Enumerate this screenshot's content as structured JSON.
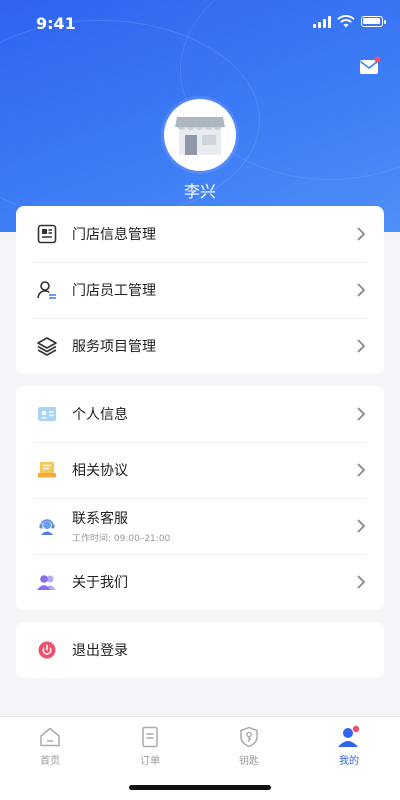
{
  "status_bar": {
    "time": "9:41"
  },
  "profile": {
    "name": "李兴"
  },
  "menu_group_1": [
    {
      "label": "门店信息管理",
      "icon": "store-info-icon"
    },
    {
      "label": "门店员工管理",
      "icon": "staff-icon"
    },
    {
      "label": "服务项目管理",
      "icon": "layers-icon"
    }
  ],
  "menu_group_2": [
    {
      "label": "个人信息",
      "icon": "id-card-icon"
    },
    {
      "label": "相关协议",
      "icon": "agreement-icon"
    },
    {
      "label": "联系客服",
      "sublabel": "工作时间: 09:00–21:00",
      "icon": "customer-service-icon"
    },
    {
      "label": "关于我们",
      "icon": "people-icon"
    }
  ],
  "logout": {
    "label": "退出登录",
    "icon": "power-icon",
    "color": "#f0506e"
  },
  "tabbar": [
    {
      "label": "首页",
      "icon": "home-icon"
    },
    {
      "label": "订单",
      "icon": "order-icon"
    },
    {
      "label": "钥匙",
      "icon": "key-icon"
    },
    {
      "label": "我的",
      "icon": "profile-icon",
      "active": true
    }
  ],
  "colors": {
    "primary": "#2f63f0",
    "badge": "#f0506e"
  }
}
